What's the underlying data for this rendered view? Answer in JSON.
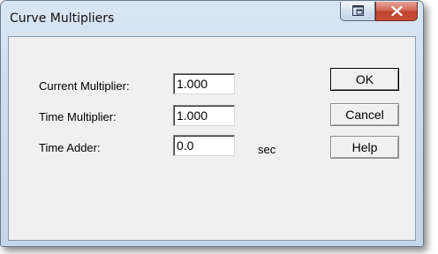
{
  "window": {
    "title": "Curve Multipliers"
  },
  "fields": {
    "current_multiplier": {
      "label": "Current Multiplier:",
      "value": "1.000"
    },
    "time_multiplier": {
      "label": "Time Multiplier:",
      "value": "1.000"
    },
    "time_adder": {
      "label": "Time Adder:",
      "value": "0.0",
      "unit": "sec"
    }
  },
  "buttons": {
    "ok": "OK",
    "cancel": "Cancel",
    "help": "Help"
  },
  "titlebar_icons": {
    "restore": "restore-icon",
    "close": "close-icon"
  },
  "colors": {
    "close_button": "#c94f37",
    "frame": "#cddcee",
    "client": "#f0f0f0"
  }
}
